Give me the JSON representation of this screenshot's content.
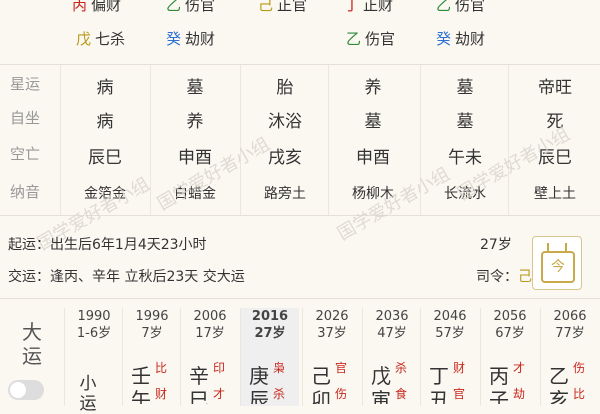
{
  "hidden_stems_row1": [
    {
      "stem": "丙",
      "god": "偏财",
      "stem_color": "#c8281e"
    },
    {
      "stem": "乙",
      "god": "伤官",
      "stem_color": "#2e8b3a"
    },
    {
      "stem": "己",
      "god": "正官",
      "stem_color": "#b89a1a"
    },
    {
      "stem": "丁",
      "god": "正财",
      "stem_color": "#c8281e"
    },
    {
      "stem": "乙",
      "god": "伤官",
      "stem_color": "#2e8b3a"
    }
  ],
  "hidden_stems_row2": [
    {
      "stem": "戊",
      "god": "七杀",
      "stem_color": "#b89a1a"
    },
    {
      "stem": "癸",
      "god": "劫财",
      "stem_color": "#2a6fd1"
    },
    {
      "stem": "乙",
      "god": "伤官",
      "stem_color": "#2e8b3a"
    },
    {
      "stem": "癸",
      "god": "劫财",
      "stem_color": "#2a6fd1"
    }
  ],
  "table": {
    "labels": [
      "星运",
      "自坐",
      "空亡",
      "纳音"
    ],
    "xingyun": [
      "病",
      "墓",
      "胎",
      "养",
      "墓",
      "帝旺"
    ],
    "zizuo": [
      "病",
      "养",
      "沐浴",
      "墓",
      "墓",
      "死"
    ],
    "kongwang": [
      "辰巳",
      "申酉",
      "戌亥",
      "申酉",
      "午未",
      "辰巳"
    ],
    "nayin": [
      "金箔金",
      "白蜡金",
      "路旁土",
      "杨柳木",
      "长流水",
      "壁上土"
    ]
  },
  "watermark": "国学爱好者小组",
  "info": {
    "qiyun": "起运：出生后6年1月4天23小时",
    "jiaoyun": "交运：逢丙、辛年 立秋后23天 交大运",
    "age": "27岁",
    "siling_label": "司令：",
    "siling_value": "己",
    "calendar_char": "今"
  },
  "dayun": {
    "title": "大运",
    "xiaoyun_label": "小运",
    "columns": [
      {
        "year": "1990",
        "age": "1-6岁",
        "type": "xiaoyun"
      },
      {
        "year": "1996",
        "age": "7岁",
        "gan": "壬",
        "gan_god": "比",
        "gan_god_color": "#c8281e",
        "zhi": "午",
        "zhi_god": "财",
        "zhi_god_color": "#c8281e"
      },
      {
        "year": "2006",
        "age": "17岁",
        "gan": "辛",
        "gan_god": "印",
        "gan_god_color": "#c8281e",
        "zhi": "巳",
        "zhi_god": "才",
        "zhi_god_color": "#c8281e"
      },
      {
        "year": "2016",
        "age": "27岁",
        "gan": "庚",
        "gan_god": "枭",
        "gan_god_color": "#c8281e",
        "zhi": "辰",
        "zhi_god": "杀",
        "zhi_god_color": "#c8281e",
        "active": true
      },
      {
        "year": "2026",
        "age": "37岁",
        "gan": "己",
        "gan_god": "官",
        "gan_god_color": "#c8281e",
        "zhi": "卯",
        "zhi_god": "伤",
        "zhi_god_color": "#c8281e"
      },
      {
        "year": "2036",
        "age": "47岁",
        "gan": "戊",
        "gan_god": "杀",
        "gan_god_color": "#c8281e",
        "zhi": "寅",
        "zhi_god": "食",
        "zhi_god_color": "#c8281e"
      },
      {
        "year": "2046",
        "age": "57岁",
        "gan": "丁",
        "gan_god": "财",
        "gan_god_color": "#c8281e",
        "zhi": "丑",
        "zhi_god": "官",
        "zhi_god_color": "#c8281e"
      },
      {
        "year": "2056",
        "age": "67岁",
        "gan": "丙",
        "gan_god": "才",
        "gan_god_color": "#c8281e",
        "zhi": "子",
        "zhi_god": "劫",
        "zhi_god_color": "#c8281e"
      },
      {
        "year": "2066",
        "age": "77岁",
        "gan": "乙",
        "gan_god": "伤",
        "gan_god_color": "#c8281e",
        "zhi": "亥",
        "zhi_god": "比",
        "zhi_god_color": "#c8281e"
      }
    ]
  }
}
